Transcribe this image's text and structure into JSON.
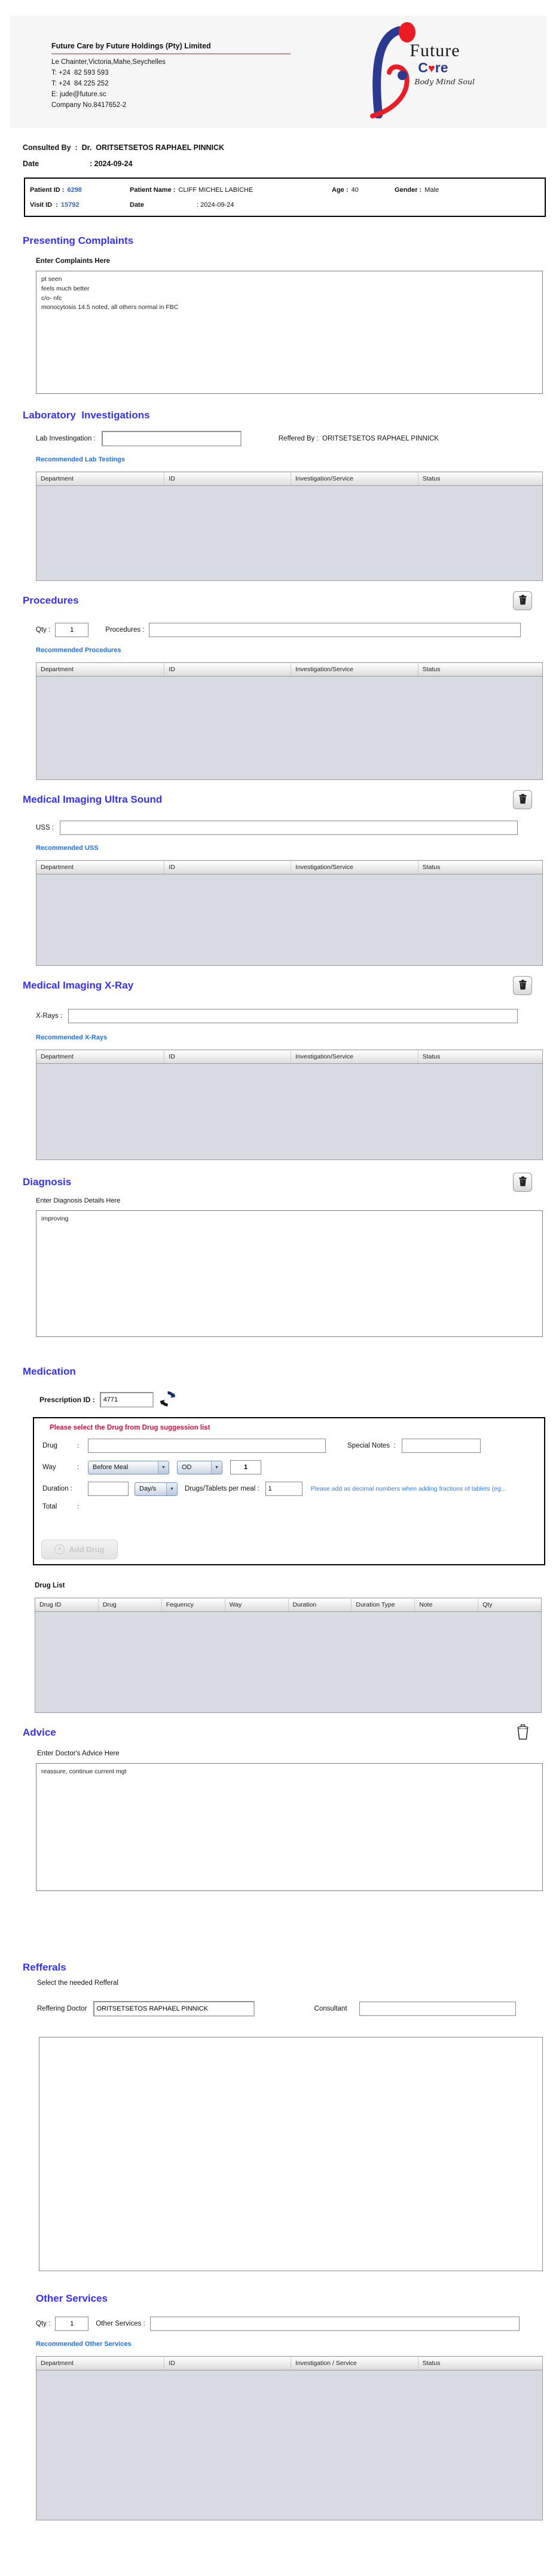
{
  "letterhead": {
    "company_name": "Future Care by Future Holdings (Pty) Limited",
    "address": "Le Chainter,Victoria,Mahe,Seychelles",
    "phone1": "T: +24  82 593 593",
    "phone2": "T: +24  84 225 252",
    "email": "E: jude@future.sc",
    "company_no": "Company No.8417652-2",
    "logo": {
      "future": "Future",
      "care_c": "C",
      "heart": "♥",
      "care_re": "re",
      "tagline": "Body Mind Soul"
    }
  },
  "consulted_by": "Consulted By  :  Dr.  ORITSETSETOS RAPHAEL PINNICK",
  "visit_date": {
    "label": "Date",
    "value": ": 2024-09-24"
  },
  "patient": {
    "id_label": "Patient ID :",
    "id": "6298",
    "name_label": "Patient Name :",
    "name": "CLIFF MICHEL LABICHE",
    "age_label": "Age :",
    "age": "40",
    "gender_label": "Gender :",
    "gender": "Male",
    "visit_label": "Visit ID  :",
    "visit_id": "15792",
    "date_label": "Date",
    "date": ": 2024-09-24"
  },
  "complaints": {
    "title": "Presenting Complaints",
    "label": "Enter Complaints Here",
    "text": "pt seen\nfeels much better\nc/o- nfc\nmonocytosis 14.5 noted, all others normal in FBC"
  },
  "laboratory": {
    "title": "Laboratory  Investigations",
    "field_label": "Lab Investingation :",
    "field_value": "",
    "referred_label": "Reffered By :  ORITSETSETOS RAPHAEL PINNICK",
    "recommended": "Recommended Lab Testings",
    "headers": [
      "Department",
      "ID",
      "Investigation/Service",
      "Status"
    ]
  },
  "procedures": {
    "title": "Procedures",
    "qty_label": "Qty :",
    "qty": "1",
    "field_label": "Procedures :",
    "field_value": "",
    "recommended": "Recommended Procedures",
    "headers": [
      "Department",
      "ID",
      "Investigation/Service",
      "Status"
    ]
  },
  "ultrasound": {
    "title": "Medical Imaging Ultra Sound",
    "field_label": "USS :",
    "field_value": "",
    "recommended": "Recommended USS",
    "headers": [
      "Department",
      "ID",
      "Investigation/Service",
      "Status"
    ]
  },
  "xray": {
    "title": "Medical Imaging X-Ray",
    "field_label": "X-Rays :",
    "field_value": "",
    "recommended": "Recommended X-Rays",
    "headers": [
      "Department",
      "ID",
      "Investigation/Service",
      "Status"
    ]
  },
  "diagnosis": {
    "title": "Diagnosis",
    "label": "Enter Diagnosis Details Here",
    "text": "improving"
  },
  "medication": {
    "title": "Medication",
    "prescription_label": "Prescription ID :",
    "prescription_id": "4771",
    "warning": "Please select the Drug from Drug suggession list",
    "drug_label": "Drug",
    "colon": ":",
    "drug_value": "",
    "special_notes_label": "Special Notes  :",
    "special_notes_value": "",
    "way_label": "Way",
    "meal_option": "Before Meal",
    "frequency_option": "OD",
    "frequency_qty": "1",
    "duration_label": "Duration :",
    "duration_value": "",
    "duration_unit": "Day/s",
    "per_meal_label": "Drugs/Tablets per meal :",
    "per_meal_value": "1",
    "decimal_note": "Please add as decimal numbers when adding fractions of tablets (eg...",
    "total_label": "Total",
    "total_value": "",
    "add_drug_label": "Add Drug",
    "drug_list_label": "Drug List",
    "drug_headers": [
      "Drug ID",
      "Drug",
      "Fequency",
      "Way",
      "Duration",
      "Duration Type",
      "Note",
      "Qty"
    ]
  },
  "advice": {
    "title": "Advice",
    "label": "Enter Doctor's Advice Here",
    "text": "reassure, continue current mgt"
  },
  "referrals": {
    "title": "Refferals",
    "subtitle": "Select the needed Refferal",
    "doctor_label": "Reffering Doctor",
    "doctor_value": "ORITSETSETOS RAPHAEL PINNICK",
    "consultant_label": "Consultant",
    "consultant_value": ""
  },
  "other_services": {
    "title": "Other Services",
    "qty_label": "Qty :",
    "qty": "1",
    "field_label": "Other Services :",
    "field_value": "",
    "recommended": "Recommended Other Services",
    "headers": [
      "Department",
      "ID",
      "Investigation / Service",
      "Status"
    ]
  },
  "icons": {
    "dropdown_arrow": "▼",
    "plus": "+"
  },
  "colors": {
    "heading": "#3431f0",
    "link": "#1b6ff0",
    "id_text": "#3366cc",
    "warning": "#d3103f"
  }
}
